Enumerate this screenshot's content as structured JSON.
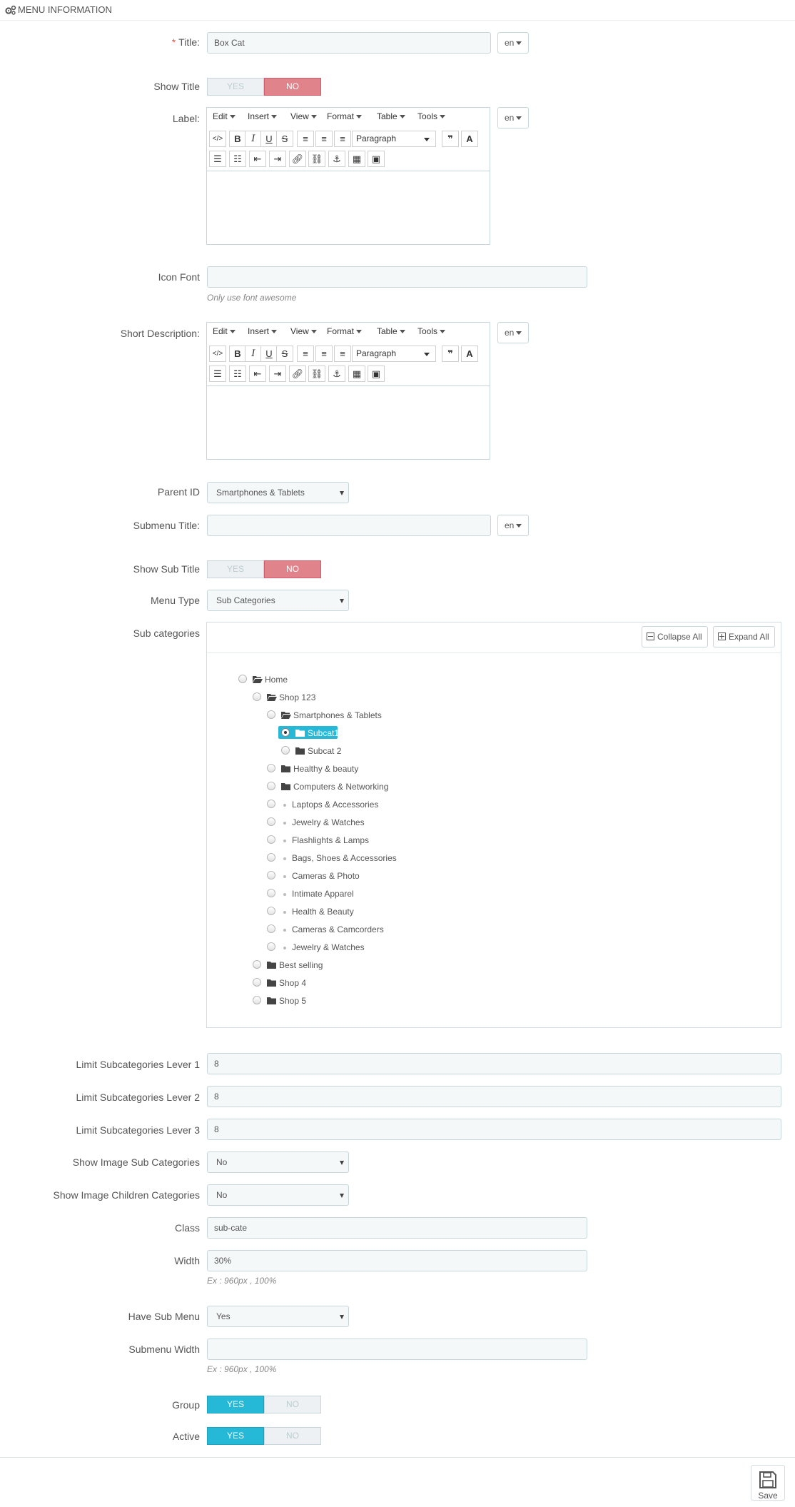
{
  "heading": "MENU INFORMATION",
  "title_field": {
    "label": "Title:",
    "value": "Box Cat",
    "lang": "en"
  },
  "show_title": {
    "label": "Show Title",
    "yes": "YES",
    "no": "NO",
    "value": "NO"
  },
  "label_field": {
    "label": "Label:",
    "lang": "en"
  },
  "editor": {
    "menus": [
      "Edit",
      "Insert",
      "View",
      "Format",
      "Table",
      "Tools"
    ],
    "paragraph": "Paragraph"
  },
  "icon_font": {
    "label": "Icon Font",
    "value": "",
    "help": "Only use font awesome"
  },
  "short_description": {
    "label": "Short Description:",
    "lang": "en"
  },
  "parent_id": {
    "label": "Parent ID",
    "value": "Smartphones & Tablets"
  },
  "submenu_title": {
    "label": "Submenu Title:",
    "value": "",
    "lang": "en"
  },
  "show_sub_title": {
    "label": "Show Sub Title",
    "yes": "YES",
    "no": "NO",
    "value": "NO"
  },
  "menu_type": {
    "label": "Menu Type",
    "value": "Sub Categories"
  },
  "sub_categories": {
    "label": "Sub categories",
    "collapse_all": "Collapse All",
    "expand_all": "Expand All",
    "tree": [
      {
        "name": "Home",
        "depth": 0,
        "kind": "folder-open",
        "selected": false
      },
      {
        "name": "Shop 123",
        "depth": 1,
        "kind": "folder-open",
        "selected": false
      },
      {
        "name": "Smartphones & Tablets",
        "depth": 2,
        "kind": "folder-open",
        "selected": false
      },
      {
        "name": "Subcat1",
        "depth": 3,
        "kind": "folder",
        "selected": true
      },
      {
        "name": "Subcat 2",
        "depth": 3,
        "kind": "folder",
        "selected": false
      },
      {
        "name": "Healthy & beauty",
        "depth": 2,
        "kind": "folder",
        "selected": false
      },
      {
        "name": "Computers & Networking",
        "depth": 2,
        "kind": "folder",
        "selected": false
      },
      {
        "name": "Laptops & Accessories",
        "depth": 2,
        "kind": "leaf",
        "selected": false
      },
      {
        "name": "Jewelry & Watches",
        "depth": 2,
        "kind": "leaf",
        "selected": false
      },
      {
        "name": "Flashlights & Lamps",
        "depth": 2,
        "kind": "leaf",
        "selected": false
      },
      {
        "name": "Bags, Shoes & Accessories",
        "depth": 2,
        "kind": "leaf",
        "selected": false
      },
      {
        "name": "Cameras & Photo",
        "depth": 2,
        "kind": "leaf",
        "selected": false
      },
      {
        "name": "Intimate Apparel",
        "depth": 2,
        "kind": "leaf",
        "selected": false
      },
      {
        "name": "Health & Beauty",
        "depth": 2,
        "kind": "leaf",
        "selected": false
      },
      {
        "name": "Cameras & Camcorders",
        "depth": 2,
        "kind": "leaf",
        "selected": false
      },
      {
        "name": "Jewelry & Watches",
        "depth": 2,
        "kind": "leaf",
        "selected": false
      },
      {
        "name": "Best selling",
        "depth": 1,
        "kind": "folder",
        "selected": false
      },
      {
        "name": "Shop 4",
        "depth": 1,
        "kind": "folder",
        "selected": false
      },
      {
        "name": "Shop 5",
        "depth": 1,
        "kind": "folder",
        "selected": false
      }
    ]
  },
  "limit_1": {
    "label": "Limit Subcategories Lever 1",
    "value": "8"
  },
  "limit_2": {
    "label": "Limit Subcategories Lever 2",
    "value": "8"
  },
  "limit_3": {
    "label": "Limit Subcategories Lever 3",
    "value": "8"
  },
  "show_image_sub": {
    "label": "Show Image Sub Categories",
    "value": "No"
  },
  "show_image_children": {
    "label": "Show Image Children Categories",
    "value": "No"
  },
  "class_field": {
    "label": "Class",
    "value": "sub-cate"
  },
  "width_field": {
    "label": "Width",
    "value": "30%",
    "help": "Ex : 960px , 100%"
  },
  "have_sub_menu": {
    "label": "Have Sub Menu",
    "value": "Yes"
  },
  "submenu_width": {
    "label": "Submenu Width",
    "value": "",
    "help": "Ex : 960px , 100%"
  },
  "group": {
    "label": "Group",
    "yes": "YES",
    "no": "NO",
    "value": "YES"
  },
  "active": {
    "label": "Active",
    "yes": "YES",
    "no": "NO",
    "value": "YES"
  },
  "save_label": "Save",
  "colors": {
    "accent": "#25b9d7",
    "no_active": "#e0838b",
    "input_bg": "#f5f8f9",
    "border": "#c7d6db"
  }
}
